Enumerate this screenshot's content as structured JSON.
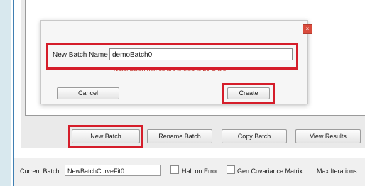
{
  "dialog": {
    "close_icon": "close-icon",
    "close_glyph": "×",
    "name_label": "New Batch Name",
    "name_value": "demoBatch0",
    "note": "Note: Batch names are limited to 20 chars",
    "cancel_label": "Cancel",
    "create_label": "Create"
  },
  "toolbar": {
    "new_batch_label": "New Batch",
    "rename_batch_label": "Rename Batch",
    "copy_batch_label": "Copy Batch",
    "view_results_label": "View Results"
  },
  "status": {
    "current_batch_label": "Current Batch:",
    "current_batch_value": "NewBatchCurveFit0",
    "halt_on_error_label": "Halt on Error",
    "gen_covariance_label": "Gen Covariance Matrix",
    "max_iterations_label": "Max Iterations"
  },
  "colors": {
    "highlight": "#d51d2a",
    "note_text": "#c2291f",
    "close_button": "#d94b3c",
    "accent_line": "#3f7fb2"
  }
}
